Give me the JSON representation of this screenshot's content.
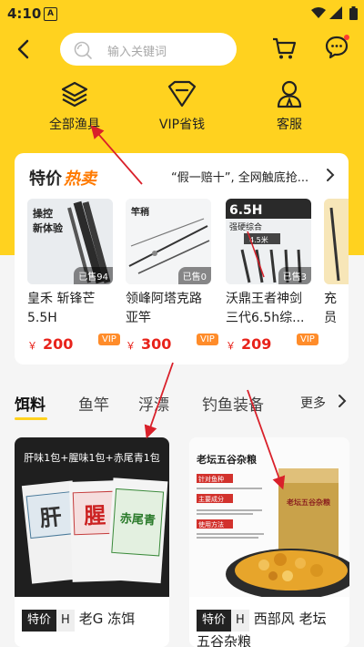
{
  "status": {
    "time": "4:10",
    "notice": "A"
  },
  "search": {
    "placeholder": "输入关键词"
  },
  "quicknav": [
    {
      "label": "全部渔具",
      "icon": "layers-icon"
    },
    {
      "label": "VIP省钱",
      "icon": "diamond-icon"
    },
    {
      "label": "客服",
      "icon": "person-icon"
    }
  ],
  "hot": {
    "title_1": "特价",
    "title_2": "热卖",
    "subtitle": "“假一赔十”, 全网触底抢...",
    "products": [
      {
        "name": "皇禾 斩锋芒5.5H",
        "price": "200",
        "sold": "已售94",
        "img_text": [
          "操控",
          "新体验"
        ]
      },
      {
        "name": "领峰阿塔克路亚竿",
        "price": "300",
        "sold": "已售0",
        "img_text": [
          "竿稍"
        ]
      },
      {
        "name": "沃鼎王者神剑三代6.5h综...",
        "price": "209",
        "sold": "已售3",
        "img_text": [
          "6.5H",
          "强硬综合",
          "4.5米"
        ]
      },
      {
        "name": "充员",
        "price": "",
        "sold": "",
        "img_text": []
      }
    ],
    "yen": "￥",
    "vip": "VIP"
  },
  "tabs": {
    "items": [
      "饵料",
      "鱼竿",
      "浮漂",
      "钓鱼装备"
    ],
    "more": "更多"
  },
  "goods": [
    {
      "tag": "特价",
      "tag2": "H",
      "name": "老G 冻饵",
      "img_banner": "肝味1包+腥味1包+赤尾青1包",
      "bag_labels": [
        "肝",
        "腥",
        "赤尾青"
      ]
    },
    {
      "tag": "特价",
      "tag2": "H",
      "name": "西部风 老坛",
      "name2": "五谷杂粮",
      "img_banner": "老坛五谷杂粮",
      "img_lines": [
        "针对鱼种",
        "主要成分",
        "使用方法"
      ],
      "bag_label": "老坛五谷杂粮"
    }
  ],
  "colors": {
    "brand_yellow": "#ffd21f",
    "price_red": "#e8231b",
    "arrow_red": "#d9202a"
  }
}
